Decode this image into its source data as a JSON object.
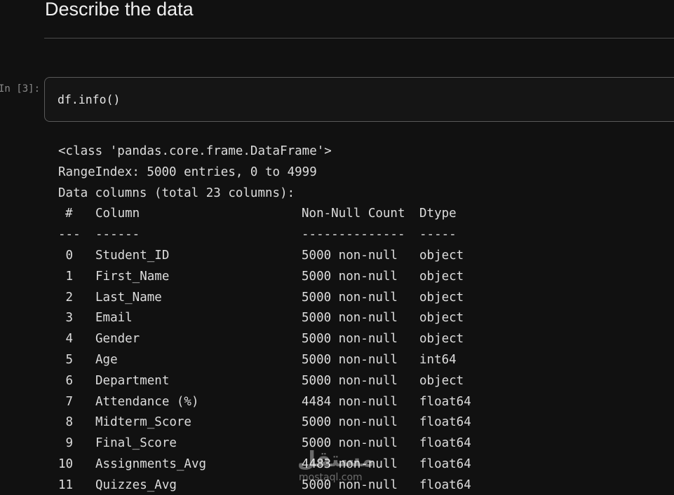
{
  "markdown": {
    "heading": "Describe the data"
  },
  "cell": {
    "prompt": "In [3]:",
    "code": "df.info()"
  },
  "output": {
    "lines": [
      "<class 'pandas.core.frame.DataFrame'>",
      "RangeIndex: 5000 entries, 0 to 4999",
      "Data columns (total 23 columns):"
    ],
    "header": {
      "idx": "#",
      "column": "Column",
      "non_null": "Non-Null Count",
      "dtype": "Dtype"
    },
    "separator": {
      "idx": "---",
      "column": "------",
      "non_null": "--------------",
      "dtype": "-----"
    },
    "rows": [
      {
        "idx": "0",
        "column": "Student_ID",
        "non_null": "5000 non-null",
        "dtype": "object"
      },
      {
        "idx": "1",
        "column": "First_Name",
        "non_null": "5000 non-null",
        "dtype": "object"
      },
      {
        "idx": "2",
        "column": "Last_Name",
        "non_null": "5000 non-null",
        "dtype": "object"
      },
      {
        "idx": "3",
        "column": "Email",
        "non_null": "5000 non-null",
        "dtype": "object"
      },
      {
        "idx": "4",
        "column": "Gender",
        "non_null": "5000 non-null",
        "dtype": "object"
      },
      {
        "idx": "5",
        "column": "Age",
        "non_null": "5000 non-null",
        "dtype": "int64"
      },
      {
        "idx": "6",
        "column": "Department",
        "non_null": "5000 non-null",
        "dtype": "object"
      },
      {
        "idx": "7",
        "column": "Attendance (%)",
        "non_null": "4484 non-null",
        "dtype": "float64"
      },
      {
        "idx": "8",
        "column": "Midterm_Score",
        "non_null": "5000 non-null",
        "dtype": "float64"
      },
      {
        "idx": "9",
        "column": "Final_Score",
        "non_null": "5000 non-null",
        "dtype": "float64"
      },
      {
        "idx": "10",
        "column": "Assignments_Avg",
        "non_null": "4483 non-null",
        "dtype": "float64"
      },
      {
        "idx": "11",
        "column": "Quizzes_Avg",
        "non_null": "5000 non-null",
        "dtype": "float64"
      }
    ]
  },
  "watermark": {
    "arabic": "مستقل",
    "latin": "mostaql.com"
  }
}
